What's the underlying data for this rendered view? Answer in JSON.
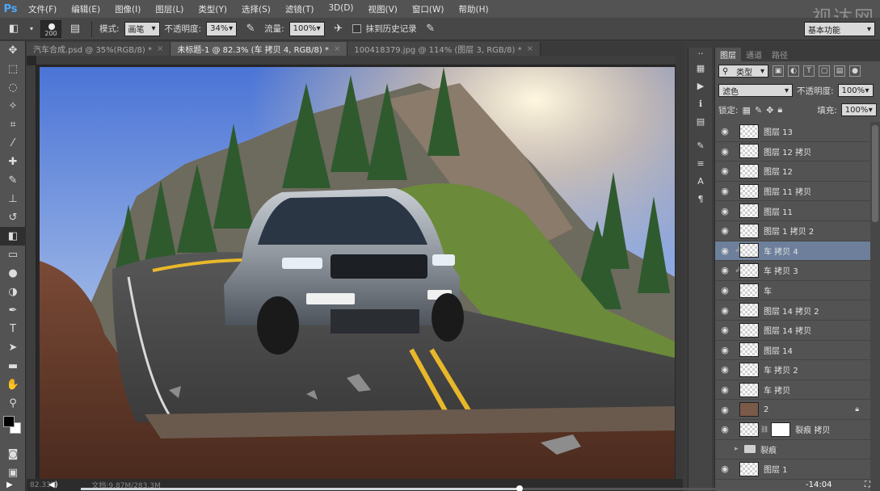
{
  "app": {
    "logo": "Ps",
    "watermark": "视达网"
  },
  "menu": [
    "文件(F)",
    "编辑(E)",
    "图像(I)",
    "图层(L)",
    "类型(Y)",
    "选择(S)",
    "滤镜(T)",
    "3D(D)",
    "视图(V)",
    "窗口(W)",
    "帮助(H)"
  ],
  "options": {
    "brush_size": "200",
    "mode_label": "模式:",
    "mode_value": "画笔",
    "opacity_label": "不透明度:",
    "opacity_value": "34%",
    "flow_label": "流量:",
    "flow_value": "100%",
    "history_label": "抹到历史记录",
    "workspace": "基本功能"
  },
  "tabs": [
    {
      "label": "汽车合成.psd @ 35%(RGB/8) *",
      "active": false
    },
    {
      "label": "未标题-1 @ 82.3% (车 拷贝 4, RGB/8) *",
      "active": true
    },
    {
      "label": "100418379.jpg @ 114% (图层 3, RGB/8) *",
      "active": false
    }
  ],
  "status": {
    "zoom": "82.33%",
    "doc": "文档:9.87M/283.3M"
  },
  "video": {
    "time": "-14:04",
    "progress": 0.59
  },
  "panel": {
    "tabs": [
      "图层",
      "通道",
      "路径"
    ],
    "filter_label": "类型",
    "blend_mode": "滤色",
    "opacity_label": "不透明度:",
    "opacity_value": "100%",
    "lock_label": "锁定:",
    "fill_label": "填充:",
    "fill_value": "100%"
  },
  "layers": [
    {
      "name": "图层 13",
      "kind": "plain"
    },
    {
      "name": "图层 12 拷贝",
      "kind": "plain"
    },
    {
      "name": "图层 12",
      "kind": "plain"
    },
    {
      "name": "图层 11 拷贝",
      "kind": "plain"
    },
    {
      "name": "图层 11",
      "kind": "plain"
    },
    {
      "name": "图层 1 拷贝 2",
      "kind": "plain"
    },
    {
      "name": "车 拷贝 4",
      "kind": "clip",
      "selected": true
    },
    {
      "name": "车 拷贝 3",
      "kind": "clip"
    },
    {
      "name": "车",
      "kind": "smart"
    },
    {
      "name": "图层 14 拷贝 2",
      "kind": "plain"
    },
    {
      "name": "图层 14 拷贝",
      "kind": "plain"
    },
    {
      "name": "图层 14",
      "kind": "plain"
    },
    {
      "name": "车 拷贝 2",
      "kind": "plain"
    },
    {
      "name": "车 拷贝",
      "kind": "plain"
    },
    {
      "name": "2",
      "kind": "photo",
      "locked": true
    },
    {
      "name": "裂痕 拷贝",
      "kind": "masked"
    },
    {
      "name": "裂痕",
      "kind": "group",
      "hidden": true
    },
    {
      "name": "图层 1",
      "kind": "plain"
    }
  ]
}
